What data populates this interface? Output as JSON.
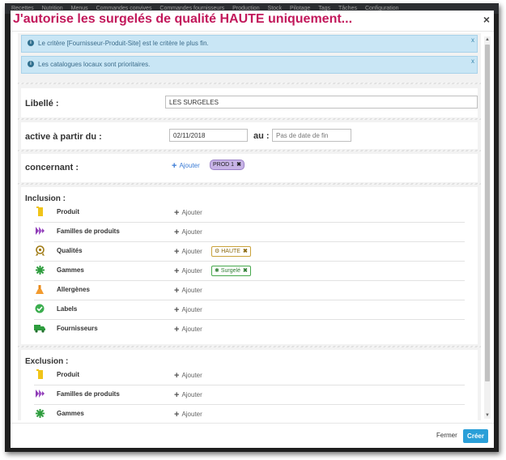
{
  "appbar": {
    "items": [
      "Recettes",
      "Nutrition",
      "Menus",
      "Commandes convives",
      "Commandes fournisseurs",
      "Production",
      "Stock",
      "Pilotage",
      "Tags",
      "Tâches",
      "Configuration"
    ]
  },
  "modal": {
    "title": "J'autorise les surgelés de qualité HAUTE uniquement...",
    "close_symbol": "×"
  },
  "alerts": [
    {
      "text": "Le critère [Fournisseur-Produit-Site] est le critère le plus fin.",
      "close": "x"
    },
    {
      "text": "Les catalogues locaux sont prioritaires.",
      "close": "x"
    }
  ],
  "form": {
    "libelle_label": "Libellé :",
    "libelle_value": "LES SURGELES",
    "active_label": "active à partir du :",
    "date_start": "02/11/2018",
    "au_label": "au :",
    "date_end_placeholder": "Pas de date de fin",
    "concernant_label": "concernant :",
    "add_label": "Ajouter",
    "concernant_tag": "PROD 1",
    "tag_remove": "✖"
  },
  "inclusion": {
    "title": "Inclusion :",
    "rows": [
      {
        "icon": "produit-icon",
        "label": "Produit",
        "add": "Ajouter"
      },
      {
        "icon": "familles-icon",
        "label": "Familles de produits",
        "add": "Ajouter"
      },
      {
        "icon": "qualites-icon",
        "label": "Qualités",
        "add": "Ajouter",
        "tag": "HAUTE"
      },
      {
        "icon": "gammes-icon",
        "label": "Gammes",
        "add": "Ajouter",
        "tag": "Surgelé"
      },
      {
        "icon": "allergenes-icon",
        "label": "Allergènes",
        "add": "Ajouter"
      },
      {
        "icon": "labels-icon",
        "label": "Labels",
        "add": "Ajouter"
      },
      {
        "icon": "fournisseurs-icon",
        "label": "Fournisseurs",
        "add": "Ajouter"
      }
    ]
  },
  "exclusion": {
    "title": "Exclusion :",
    "rows": [
      {
        "icon": "produit-icon",
        "label": "Produit",
        "add": "Ajouter"
      },
      {
        "icon": "familles-icon",
        "label": "Familles de produits",
        "add": "Ajouter"
      },
      {
        "icon": "gammes-icon",
        "label": "Gammes",
        "add": "Ajouter"
      }
    ]
  },
  "footer": {
    "close_label": "Fermer",
    "create_label": "Créer"
  },
  "colors": {
    "accent": "#2a9fd8",
    "title": "#c2185b",
    "alert_bg": "#c9e6f5",
    "tag_prod": "#c7b3e6",
    "tag_haute": "#caa23a",
    "tag_surgele": "#46a84c"
  }
}
